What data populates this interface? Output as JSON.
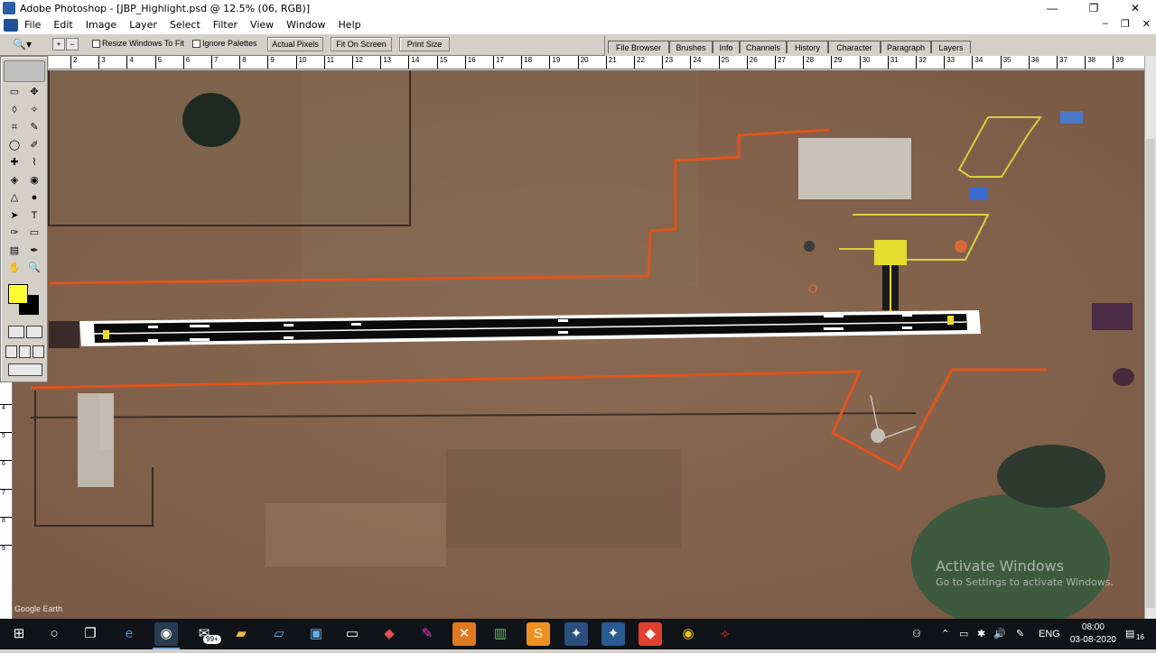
{
  "window": {
    "title": "Adobe Photoshop - [JBP_Highlight.psd @ 12.5% (06, RGB)]",
    "controls": {
      "minimize": "—",
      "maximize": "❐",
      "close": "✕"
    },
    "doc_controls": {
      "minimize": "–",
      "restore": "❐",
      "close": "✕"
    }
  },
  "menu": [
    "File",
    "Edit",
    "Image",
    "Layer",
    "Select",
    "Filter",
    "View",
    "Window",
    "Help"
  ],
  "options": {
    "zoom_in": "+",
    "zoom_out": "−",
    "resize_windows": "Resize Windows To Fit",
    "ignore_palettes": "Ignore Palettes",
    "actual_pixels": "Actual Pixels",
    "fit_on_screen": "Fit On Screen",
    "print_size": "Print Size"
  },
  "palette_tabs": [
    "File Browser",
    "Brushes",
    "Info",
    "Channels",
    "History",
    "Character",
    "Paragraph",
    "Layers"
  ],
  "ruler_h": [
    "2",
    "3",
    "4",
    "5",
    "6",
    "7",
    "8",
    "9",
    "10",
    "11",
    "12",
    "13",
    "14",
    "15",
    "16",
    "17",
    "18",
    "19",
    "20",
    "21",
    "22",
    "23",
    "24",
    "25",
    "26",
    "27",
    "28",
    "29",
    "30",
    "31",
    "32",
    "33",
    "34",
    "35",
    "36",
    "37",
    "38",
    "39"
  ],
  "ruler_v": [
    "4",
    "5",
    "6",
    "7",
    "8",
    "9"
  ],
  "toolbox": {
    "tools": [
      "▭",
      "✥",
      "◊",
      "✧",
      "⌗",
      "✎",
      "◯",
      "✐",
      "✚",
      "⌇",
      "◈",
      "◉",
      "△",
      "●",
      "➤",
      "T",
      "✑",
      "▭",
      "▤",
      "✒",
      "✋",
      "🔍"
    ],
    "foreground": "#ffff33",
    "background": "#000000"
  },
  "watermark": {
    "line1": "Activate Windows",
    "line2": "Go to Settings to activate Windows."
  },
  "attribution": "Google Earth",
  "taskbar": {
    "badge": "99+",
    "language": "ENG",
    "time": "08:00",
    "date": "03-08-2020",
    "notifications": "16"
  }
}
